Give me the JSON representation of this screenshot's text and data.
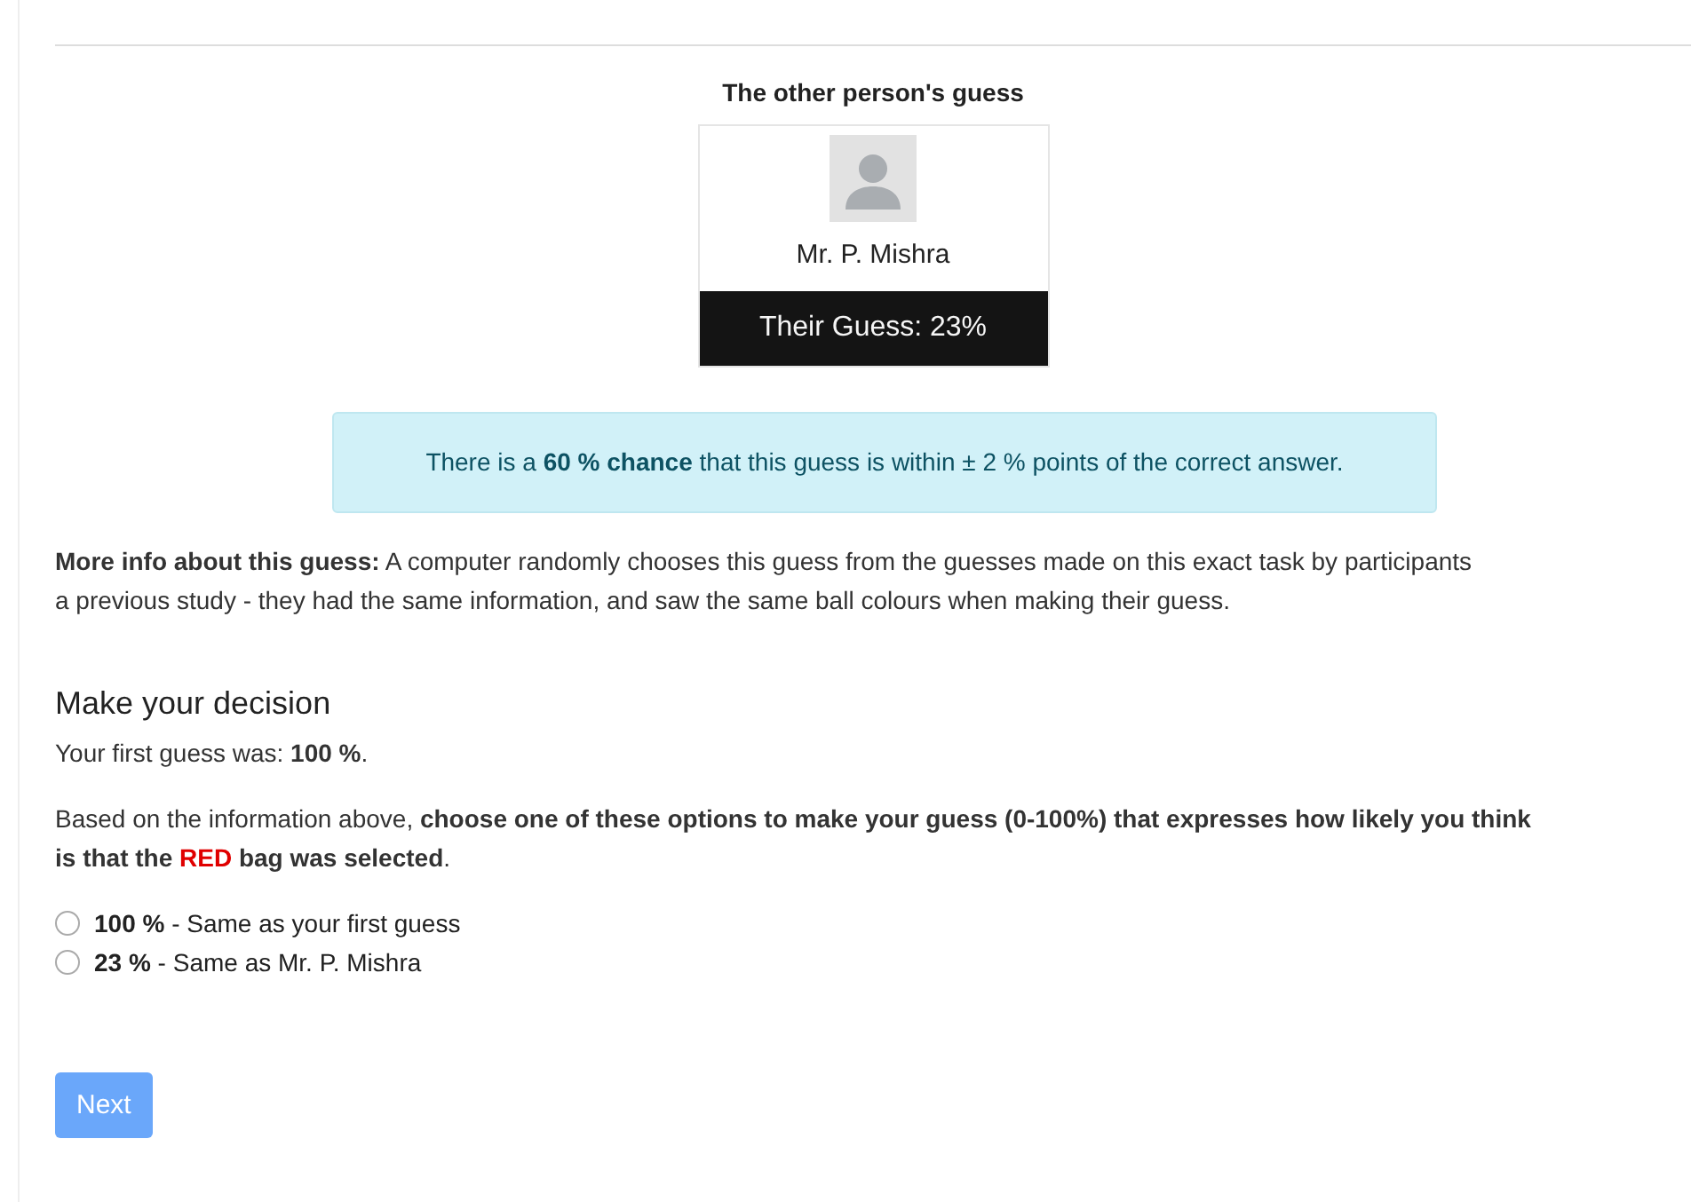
{
  "card_heading": "The other person's guess",
  "person": {
    "name": "Mr. P. Mishra",
    "guess": "Their Guess: 23%"
  },
  "alert": "There is a **60 % chance** that this guess is within ± 2 % points of the correct answer.",
  "info": "**More info about this guess:** A computer randomly chooses this guess from the guesses made on this exact task by participants\na previous study - they had the same information, and saw the same ball colours when making their guess.",
  "decision": {
    "heading": "Make your decision",
    "first_guess": "Your first guess was: **100 %**.",
    "prompt_start": "Based on the information above, ",
    "prompt_bold": "choose one of these options to make your guess (0-100%) that expresses how likely you think\nis that the ",
    "prompt_red": "RED",
    "prompt_bold_end": " bag was selected",
    "prompt_end": ".",
    "options": [
      {
        "label": "**100 %** - Same as your first guess",
        "selected": false
      },
      {
        "label": "**23 %** - Same as Mr. P. Mishra",
        "selected": false
      }
    ]
  },
  "next_button": "Next"
}
